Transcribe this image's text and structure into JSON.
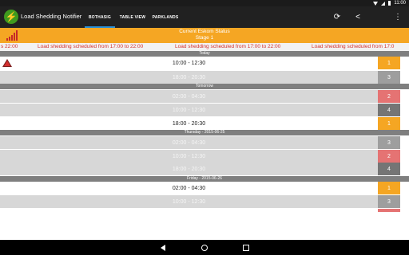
{
  "statusbar": {
    "time": "11:00"
  },
  "appbar": {
    "title": "Load Shedding Notifier",
    "tabs": [
      {
        "label": "BOTHASIG",
        "active": true
      },
      {
        "label": "TABLE VIEW",
        "active": false
      },
      {
        "label": "PARKLANDS",
        "active": false
      }
    ],
    "actions": [
      {
        "icon": "refresh-icon",
        "glyph": "⟳"
      },
      {
        "icon": "share-icon",
        "glyph": "<"
      },
      {
        "icon": "more-icon",
        "glyph": "⋮"
      }
    ]
  },
  "status": {
    "title": "Current Eskom Status",
    "stage": "Stage 1",
    "ticker": [
      "s 22:00",
      "Load shedding scheduled from 17:00 to 22:00",
      "Load shedding scheduled from 17:00 to 22:00",
      "Load shedding scheduled from 17:0"
    ]
  },
  "sections": [
    {
      "label": "Today",
      "slots": [
        {
          "time": "10:00 - 12:30",
          "stage": "1",
          "active": true,
          "warning": true
        },
        {
          "time": "18:00 - 20:30",
          "stage": "3",
          "active": false
        }
      ]
    },
    {
      "label": "Tomorrow",
      "slots": [
        {
          "time": "02:00 - 04:30",
          "stage": "2",
          "active": false
        },
        {
          "time": "10:00 - 12:30",
          "stage": "4",
          "active": false
        },
        {
          "time": "18:00 - 20:30",
          "stage": "1",
          "active": true
        }
      ]
    },
    {
      "label": "Thursday - 2015-06-25",
      "slots": [
        {
          "time": "02:00 - 04:30",
          "stage": "3",
          "active": false
        },
        {
          "time": "10:00 - 12:30",
          "stage": "2",
          "active": false
        },
        {
          "time": "18:00 - 20:30",
          "stage": "4",
          "active": false
        }
      ]
    },
    {
      "label": "Friday - 2015-06-26",
      "slots": [
        {
          "time": "02:00 - 04:30",
          "stage": "1",
          "active": true
        },
        {
          "time": "10:00 - 12:30",
          "stage": "3",
          "active": false
        }
      ]
    }
  ],
  "colors": {
    "header": "#f5a623",
    "stage_1": "#f5a623",
    "stage_2": "#e57373",
    "stage_3": "#9e9e9e",
    "stage_4": "#757575",
    "ticker_text": "#d32f2f",
    "tab_indicator": "#2a8fd6"
  }
}
